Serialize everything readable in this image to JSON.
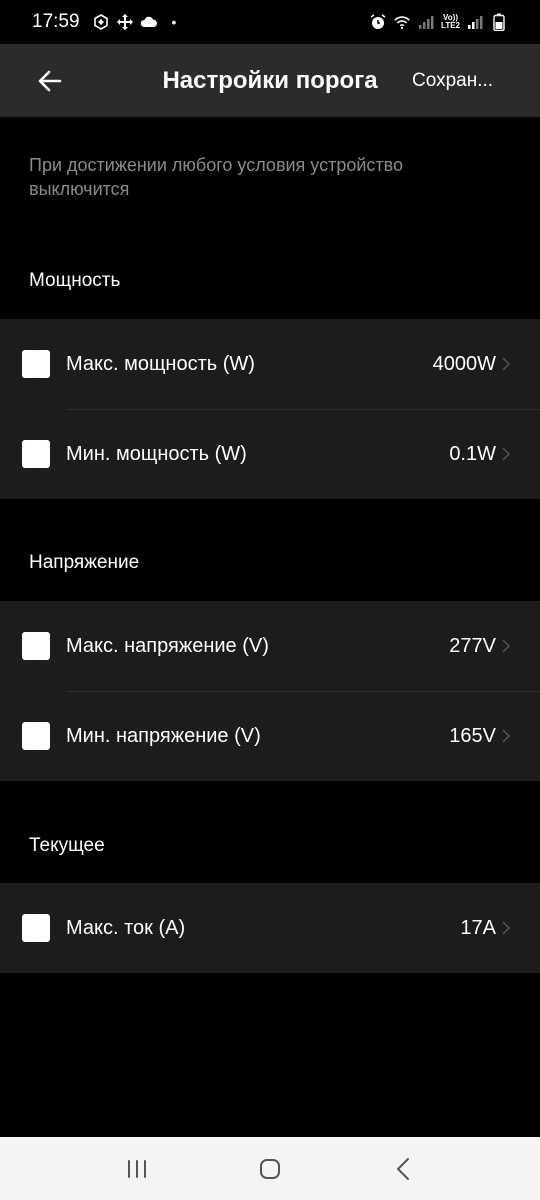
{
  "status_bar": {
    "time": "17:59",
    "dot": "•",
    "lte_top": "Vo))",
    "lte_bottom": "LTE2",
    "icons_left": [
      "nfc-icon",
      "move-icon",
      "cloud-icon"
    ],
    "icons_right": [
      "alarm-icon",
      "wifi-icon",
      "signal-icon",
      "battery-icon"
    ]
  },
  "app_bar": {
    "title": "Настройки порога",
    "save_label": "Сохран..."
  },
  "hint": "При достижении любого условия устройство выключится",
  "sections": [
    {
      "title": "Мощность",
      "rows": [
        {
          "label": "Макс. мощность (W)",
          "value": "4000W",
          "checked": false
        },
        {
          "label": "Мин. мощность (W)",
          "value": "0.1W",
          "checked": false
        }
      ]
    },
    {
      "title": "Напряжение",
      "rows": [
        {
          "label": "Макс. напряжение (V)",
          "value": "277V",
          "checked": false
        },
        {
          "label": "Мин. напряжение (V)",
          "value": "165V",
          "checked": false
        }
      ]
    },
    {
      "title": "Текущее",
      "rows": [
        {
          "label": "Макс. ток (A)",
          "value": "17A",
          "checked": false
        }
      ]
    }
  ],
  "nav_bar": {
    "buttons": [
      "recent-apps-icon",
      "home-icon",
      "back-icon"
    ]
  },
  "colors": {
    "background": "#000000",
    "app_bar": "#2b2b2b",
    "group": "#1c1c1c",
    "hint": "#8a8a8a",
    "nav_bar": "#f4f4f4"
  }
}
